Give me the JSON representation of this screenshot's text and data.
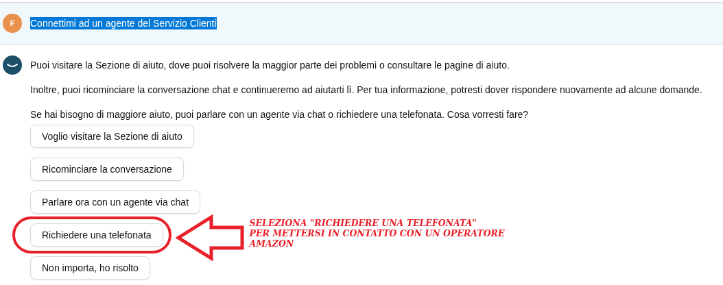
{
  "user_message": {
    "avatar": "F",
    "text": "Connettimi ad un agente del Servizio Clienti",
    "highlighted": true
  },
  "bot_message": {
    "paragraphs": [
      "Puoi visitare la Sezione di aiuto, dove puoi risolvere la maggior parte dei problemi o consultare le pagine di aiuto.",
      "Inoltre, puoi ricominciare la conversazione chat e continueremo ad aiutarti lì. Per tua informazione, potresti dover rispondere nuovamente ad alcune domande.",
      "Se hai bisogno di maggiore aiuto, puoi parlare con un agente via chat o richiedere una telefonata. Cosa vorresti fare?"
    ],
    "options": [
      {
        "label": "Voglio visitare la Sezione di aiuto",
        "circled": false
      },
      {
        "label": "Ricominciare la conversazione",
        "circled": false
      },
      {
        "label": "Parlare ora con un agente via chat",
        "circled": false
      },
      {
        "label": "Richiedere una telefonata",
        "circled": true
      },
      {
        "label": "Non importa, ho risolto",
        "circled": false
      }
    ]
  },
  "annotation": {
    "lines": [
      "SELEZIONA \"RICHIEDERE UNA TELEFONATA\"",
      "PER METTERSI IN CONTATTO CON UN OPERATORE",
      "AMAZON"
    ]
  }
}
